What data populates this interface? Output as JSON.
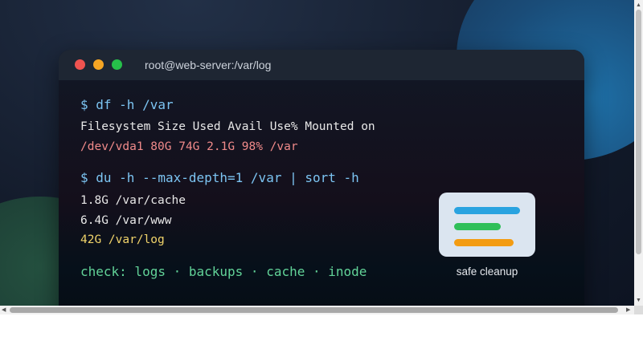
{
  "window": {
    "title": "root@web-server:/var/log"
  },
  "terminal": {
    "cmd1": "$ df -h /var",
    "header": "Filesystem Size Used Avail Use% Mounted on",
    "row": "/dev/vda1 80G 74G 2.1G 98% /var",
    "cmd2": "$ du -h --max-depth=1 /var | sort -h",
    "du": [
      "1.8G /var/cache",
      "6.4G /var/www",
      "42G /var/log"
    ],
    "check": "check: logs · backups · cache · inode"
  },
  "card": {
    "label": "safe cleanup"
  },
  "colors": {
    "command": "#7cc4f2",
    "warning": "#f08a8a",
    "highlight": "#f1d46a",
    "check": "#62d398",
    "bar_blue": "#29a3e0",
    "bar_green": "#2fbf59",
    "bar_orange": "#f39c12"
  },
  "icons": [
    "close-dot",
    "minimize-dot",
    "maximize-dot",
    "scroll-up-arrow",
    "scroll-down-arrow",
    "scroll-left-arrow",
    "scroll-right-arrow"
  ]
}
